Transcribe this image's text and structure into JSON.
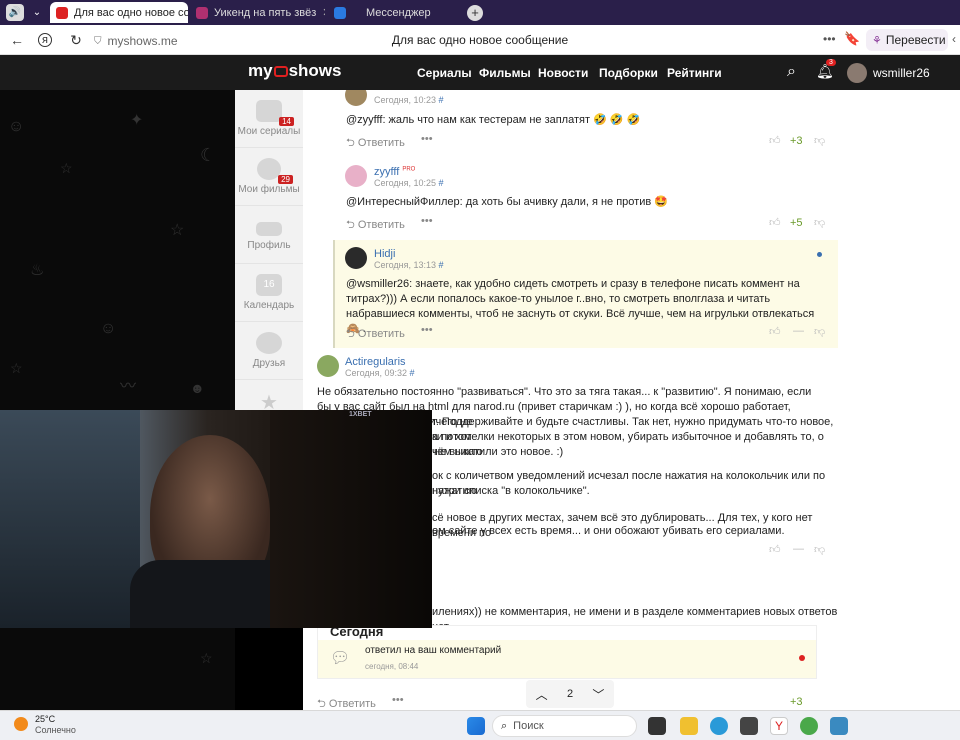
{
  "browser": {
    "tabs": [
      {
        "title": "Для вас одно новое со",
        "active": true
      },
      {
        "title": "Уикенд на пять звёз",
        "active": false
      },
      {
        "title": "Мессенджер",
        "active": false
      }
    ],
    "url": "myshows.me",
    "page_title": "Для вас одно новое сообщение",
    "translate_label": "Перевести"
  },
  "site": {
    "logo": "my shows",
    "nav": [
      "Сериалы",
      "Фильмы",
      "Новости",
      "Подборки",
      "Рейтинги"
    ],
    "notif_count": "3",
    "username": "wsmiller26"
  },
  "sidebar": [
    {
      "label": "Мои сериалы",
      "badge": "14"
    },
    {
      "label": "Мои фильмы",
      "badge": "29"
    },
    {
      "label": "Профиль",
      "badge": ""
    },
    {
      "label": "Календарь",
      "badge": "16"
    },
    {
      "label": "Друзья",
      "badge": ""
    }
  ],
  "comments": [
    {
      "time": "Сегодня, 10:23",
      "hash": "#",
      "text": "@zyyfff: жаль что нам как тестерам не заплатят 🤣 🤣 🤣",
      "reply": "Ответить",
      "more": "•••",
      "score": "+3"
    },
    {
      "author": "zyyfff",
      "time": "Сегодня, 10:25",
      "hash": "#",
      "text": "@ИнтересныйФиллер: да хоть бы ачивку дали, я не против 🤩",
      "reply": "Ответить",
      "more": "•••",
      "score": "+5"
    },
    {
      "author": "Hidji",
      "time": "Сегодня, 13:13",
      "hash": "#",
      "text": "@wsmiller26: знаете, как удобно сидеть смотреть и сразу в телефоне писать коммент на титрах?))) А если попалось какое-то унылое г..вно, то смотреть вполглаза и читать набравшиеся комменты, чтоб не заснуть от скуки. Всё лучше, чем на игрульки отвлекаться 🙈 .",
      "reply": "Ответить",
      "more": "•••",
      "score": "—"
    },
    {
      "author": "Actiregularis",
      "time": "Сегодня, 09:32",
      "hash": "#",
      "text1": "Не обязательно постоянно \"развиваться\". Что это за тяга такая... к \"развитию\". Я понимаю, если бы у вас сайт был на html для narod.ru (привет старичкам :) ), но когда всё хорошо работает, пользователи особо ничего не",
      "text1b": "т. Поддерживайте и будьте счастливы. Так нет, нужно придумать что-то новое, а потом",
      "text1c": "ки и хотелки некоторых в этом новом, убирать избыточное и добавлять то, о чём никто",
      "text1d": "не выкатили это новое. :)",
      "text2": "ок с количетвом уведомлений исчезал после нажатия на колокольчик или по нажатию",
      "text2b": "нутри списка \"в колокольчике\".",
      "text3": "сё новое в других местах, зачем всё это дублировать... Для тех, у кого нет времени по",
      "text3b": "ом сайте у всех есть время... и они обожают убивать его сериалами.",
      "score": "—"
    }
  ],
  "notif": {
    "partial": "илениях)) не комментария, не имени и в разделе комментариев новых ответов нет",
    "heading": "Сегодня",
    "text": "ответил на ваш комментарий",
    "time": "сегодня, 08:44"
  },
  "bottom": {
    "reply": "Ответить",
    "more": "•••",
    "score": "+3",
    "page": "2"
  },
  "video": {
    "watermark": "1XBET"
  },
  "taskbar": {
    "temp": "25°C",
    "weather": "Солнечно",
    "search": "Поиск"
  }
}
